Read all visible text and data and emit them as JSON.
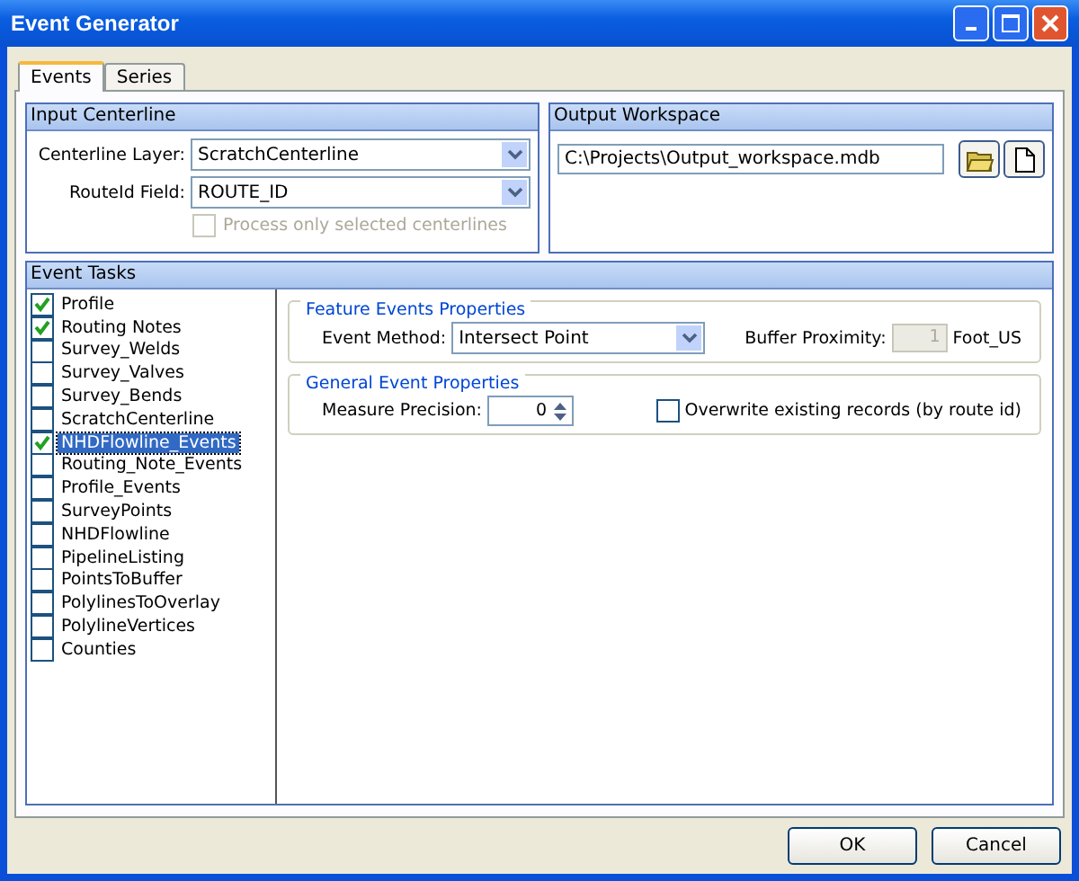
{
  "window": {
    "title": "Event Generator"
  },
  "tabs": [
    {
      "label": "Events",
      "selected": true
    },
    {
      "label": "Series",
      "selected": false
    }
  ],
  "input_centerline": {
    "title": "Input Centerline",
    "centerline_layer": {
      "label": "Centerline Layer:",
      "value": "ScratchCenterline"
    },
    "routeid_field": {
      "label": "RouteId Field:",
      "value": "ROUTE_ID"
    },
    "process_selected": {
      "label": "Process only selected centerlines",
      "checked": false,
      "disabled": true
    }
  },
  "output_workspace": {
    "title": "Output Workspace",
    "path": "C:\\Projects\\Output_workspace.mdb"
  },
  "event_tasks": {
    "title": "Event Tasks",
    "items": [
      {
        "label": "Profile",
        "checked": true,
        "selected": false
      },
      {
        "label": "Routing Notes",
        "checked": true,
        "selected": false
      },
      {
        "label": "Survey_Welds",
        "checked": false,
        "selected": false
      },
      {
        "label": "Survey_Valves",
        "checked": false,
        "selected": false
      },
      {
        "label": "Survey_Bends",
        "checked": false,
        "selected": false
      },
      {
        "label": "ScratchCenterline",
        "checked": false,
        "selected": false
      },
      {
        "label": "NHDFlowline_Events",
        "checked": true,
        "selected": true
      },
      {
        "label": "Routing_Note_Events",
        "checked": false,
        "selected": false
      },
      {
        "label": "Profile_Events",
        "checked": false,
        "selected": false
      },
      {
        "label": "SurveyPoints",
        "checked": false,
        "selected": false
      },
      {
        "label": "NHDFlowline",
        "checked": false,
        "selected": false
      },
      {
        "label": "PipelineListing",
        "checked": false,
        "selected": false
      },
      {
        "label": "PointsToBuffer",
        "checked": false,
        "selected": false
      },
      {
        "label": "PolylinesToOverlay",
        "checked": false,
        "selected": false
      },
      {
        "label": "PolylineVertices",
        "checked": false,
        "selected": false
      },
      {
        "label": "Counties",
        "checked": false,
        "selected": false
      }
    ],
    "feature_events": {
      "title": "Feature Events Properties",
      "event_method": {
        "label": "Event Method:",
        "value": "Intersect Point"
      },
      "buffer_proximity": {
        "label": "Buffer Proximity:",
        "value": "1",
        "disabled": true,
        "unit": "Foot_US"
      }
    },
    "general_events": {
      "title": "General Event Properties",
      "measure_precision": {
        "label": "Measure Precision:",
        "value": "0"
      },
      "overwrite": {
        "label": "Overwrite existing records (by route id)",
        "checked": false
      }
    }
  },
  "buttons": [
    {
      "label": "OK"
    },
    {
      "label": "Cancel"
    }
  ]
}
